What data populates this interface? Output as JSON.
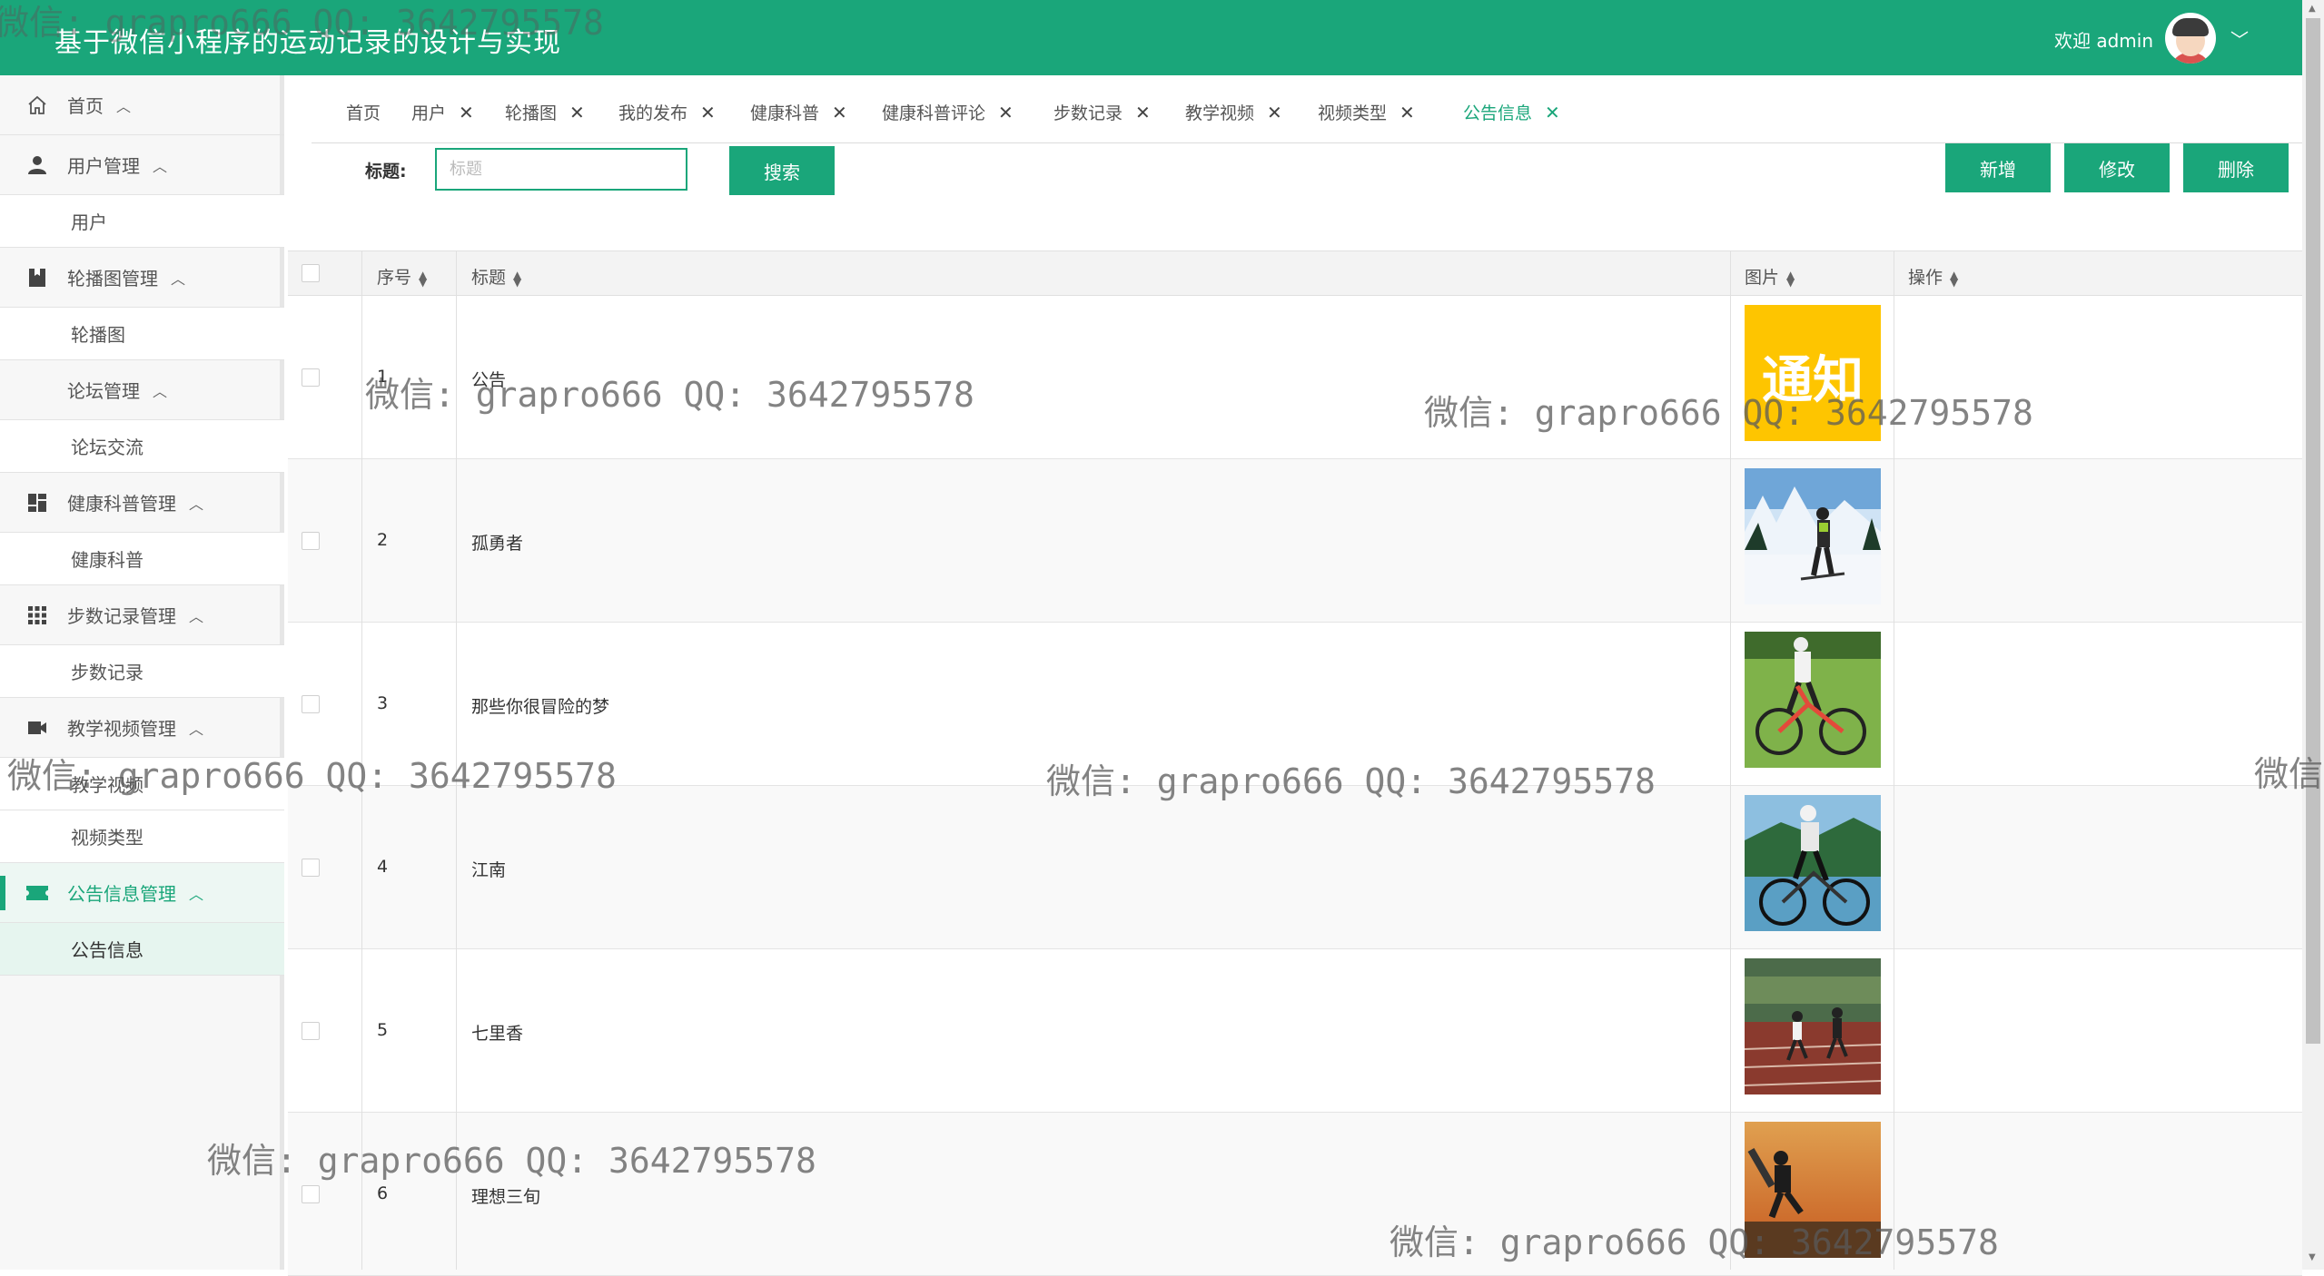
{
  "header": {
    "title": "基于微信小程序的运动记录的设计与实现",
    "welcome": "欢迎 admin",
    "caret": "﹀"
  },
  "sidebar": {
    "items": [
      {
        "type": "group",
        "label": "首页",
        "icon": "home-icon"
      },
      {
        "type": "group",
        "label": "用户管理",
        "icon": "user-icon"
      },
      {
        "type": "sub",
        "label": "用户"
      },
      {
        "type": "group",
        "label": "轮播图管理",
        "icon": "bookmark-icon"
      },
      {
        "type": "sub",
        "label": "轮播图"
      },
      {
        "type": "group",
        "label": "论坛管理",
        "icon": "forum-icon"
      },
      {
        "type": "sub",
        "label": "论坛交流"
      },
      {
        "type": "group",
        "label": "健康科普管理",
        "icon": "dashboard-icon"
      },
      {
        "type": "sub",
        "label": "健康科普"
      },
      {
        "type": "group",
        "label": "步数记录管理",
        "icon": "grid-icon"
      },
      {
        "type": "sub",
        "label": "步数记录"
      },
      {
        "type": "group",
        "label": "教学视频管理",
        "icon": "video-icon"
      },
      {
        "type": "sub",
        "label": "教学视频"
      },
      {
        "type": "sub",
        "label": "视频类型"
      },
      {
        "type": "group",
        "label": "公告信息管理",
        "icon": "ticket-icon"
      },
      {
        "type": "sub",
        "label": "公告信息"
      }
    ]
  },
  "tabs": [
    {
      "label": "首页",
      "closable": false
    },
    {
      "label": "用户",
      "closable": true
    },
    {
      "label": "轮播图",
      "closable": true
    },
    {
      "label": "我的发布",
      "closable": true
    },
    {
      "label": "健康科普",
      "closable": true
    },
    {
      "label": "健康科普评论",
      "closable": true
    },
    {
      "label": "步数记录",
      "closable": true
    },
    {
      "label": "教学视频",
      "closable": true
    },
    {
      "label": "视频类型",
      "closable": true
    },
    {
      "label": "公告信息",
      "closable": true
    }
  ],
  "search": {
    "label": "标题:",
    "placeholder": "标题",
    "button": "搜索"
  },
  "actions": {
    "add": "新增",
    "edit": "修改",
    "delete": "删除"
  },
  "table": {
    "columns": {
      "index": "序号",
      "title": "标题",
      "image": "图片",
      "operation": "操作"
    },
    "rows": [
      {
        "index": "1",
        "title": "公告",
        "image": "notice-image",
        "image_text": "通知"
      },
      {
        "index": "2",
        "title": "孤勇者",
        "image": "skiing-photo"
      },
      {
        "index": "3",
        "title": "那些你很冒险的梦",
        "image": "cycling-photo"
      },
      {
        "index": "4",
        "title": "江南",
        "image": "road-bike-photo"
      },
      {
        "index": "5",
        "title": "七里香",
        "image": "track-running-photo"
      },
      {
        "index": "6",
        "title": "理想三旬",
        "image": "skateboard-photo"
      }
    ]
  },
  "watermark": "微信: grapro666 QQ: 3642795578",
  "watermark_partial": "微信"
}
